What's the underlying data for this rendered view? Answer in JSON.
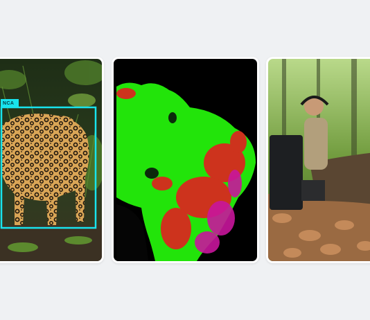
{
  "cards": [
    {
      "id": "jaguar",
      "icon": "jaguar-photo",
      "detection_label": "NCA",
      "detection_color": "#18e4ee"
    },
    {
      "id": "map",
      "icon": "satellite-map",
      "colors": {
        "forest": "#22e40a",
        "loss": "#e02020",
        "other": "#c8169c"
      }
    },
    {
      "id": "researcher",
      "icon": "field-researcher-photo"
    }
  ],
  "background": "#eff1f3"
}
